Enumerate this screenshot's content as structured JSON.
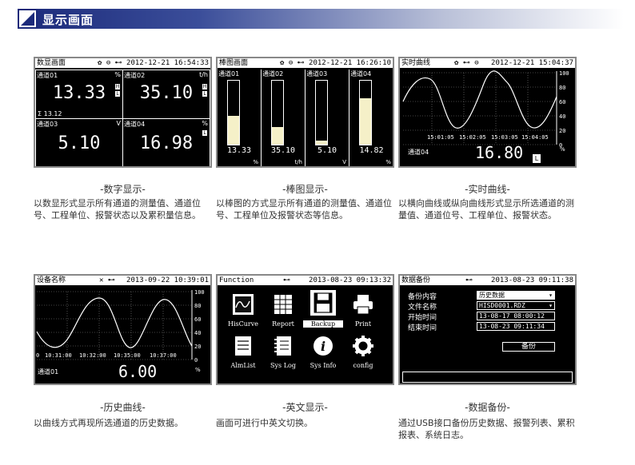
{
  "header": {
    "title": "显示画面"
  },
  "panels": {
    "digital": {
      "top_title": "数显画面",
      "icons": "✿ ⊖ ⊷",
      "datetime": "2012-12-21 16:54:33",
      "channels": [
        {
          "name": "通道01",
          "unit": "%",
          "value": "13.33"
        },
        {
          "name": "通道02",
          "unit": "t/h",
          "value": "35.10"
        },
        {
          "name": "通道03",
          "unit": "V",
          "value": "5.10"
        },
        {
          "name": "通道04",
          "unit": "%",
          "value": "16.98"
        }
      ],
      "sum": "Σ 13.12",
      "caption": "-数字显示-",
      "desc": "以数显形式显示所有通道的测量值、通道位号、工程单位、报警状态以及累积量信息。"
    },
    "bar": {
      "top_title": "棒图画面",
      "icons": "✿ ⊖ ⊷",
      "datetime": "2012-12-21 16:26:10",
      "channels": [
        {
          "name": "通道01",
          "value": "13.33",
          "unit": "%",
          "level": 0.45
        },
        {
          "name": "通道02",
          "value": "35.10",
          "unit": "t/h",
          "level": 0.28
        },
        {
          "name": "通道03",
          "value": "5.10",
          "unit": "V",
          "level": 0.06
        },
        {
          "name": "通道04",
          "value": "14.82",
          "unit": "%",
          "level": 0.72
        }
      ],
      "caption": "-棒图显示-",
      "desc": "以棒图的方式显示所有通道的测量值、通道位号、工程单位及报警状态等信息。"
    },
    "realtime": {
      "top_title": "实时曲线",
      "icons": "✿ ⊷ ⊖",
      "datetime": "2012-12-21 15:04:37",
      "scale": [
        "100",
        "80",
        "60",
        "40",
        "20",
        "0"
      ],
      "times": [
        "15:01:05",
        "15:02:05",
        "15:03:05",
        "15:04:05"
      ],
      "channel": "通道04",
      "value": "16.80",
      "unit": "%",
      "alarm": "L",
      "caption": "-实时曲线-",
      "desc": "以横向曲线或纵向曲线形式显示所选通道的测量值、通道位号、工程单位、报警状态。"
    },
    "history": {
      "top_title": "设备名称",
      "icons": "✕ ⊷",
      "datetime": "2013-09-22 10:39:01",
      "scale": [
        "100",
        "80",
        "60",
        "40",
        "20",
        "0"
      ],
      "times": [
        "0",
        "10:31:00",
        "10:32:00",
        "10:35:00",
        "10:37:00"
      ],
      "channel": "通道01",
      "value": "6.00",
      "unit": "%",
      "caption": "-历史曲线-",
      "desc": "以曲线方式再现所选通道的历史数据。"
    },
    "function": {
      "top_title": "Function",
      "icons": "⊷",
      "datetime": "2013-08-23 09:13:32",
      "items": [
        "HisCurve",
        "Report",
        "Backup",
        "Print",
        "AlmList",
        "Sys Log",
        "Sys Info",
        "config"
      ],
      "caption": "-英文显示-",
      "desc": "画面可进行中英文切换。"
    },
    "backup": {
      "top_title": "数据备份",
      "icons": "⊷",
      "datetime": "2013-08-23 09:11:38",
      "rows": [
        {
          "label": "备份内容",
          "value": "历史数据"
        },
        {
          "label": "文件名称",
          "value": "HISD0001.RDZ"
        },
        {
          "label": "开始时间",
          "value": "13-08-17 08:00:12"
        },
        {
          "label": "结束时间",
          "value": "13-08-23 09:11:34"
        }
      ],
      "button": "备份",
      "caption": "-数据备份-",
      "desc": "通过USB接口备份历史数据、报警列表、累积报表、系统日志。"
    }
  }
}
